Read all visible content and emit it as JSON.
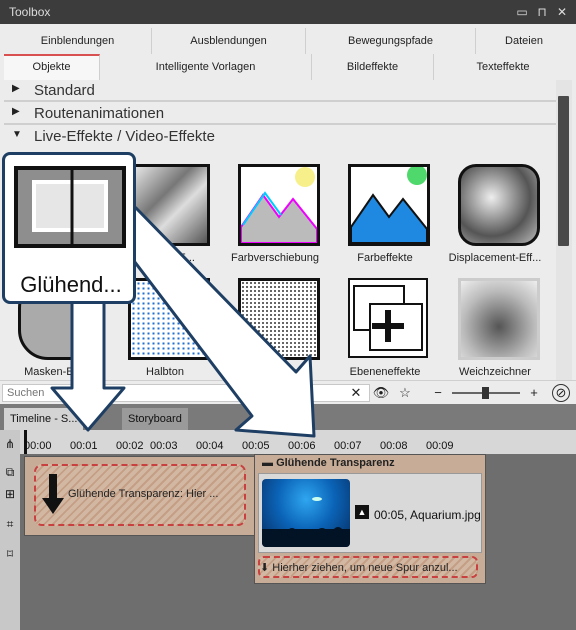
{
  "toolbox": {
    "title": "Toolbox",
    "window_controls": [
      "▭",
      "⊓",
      "✕"
    ],
    "tabs_row1": [
      "Einblendungen",
      "Ausblendungen",
      "Bewegungspfade",
      "Dateien"
    ],
    "tabs_row2": [
      "Objekte",
      "Intelligente Vorlagen",
      "Bildeffekte",
      "Texteffekte"
    ],
    "active_tab": "Objekte",
    "categories": [
      {
        "label": "Standard",
        "expanded": false
      },
      {
        "label": "Routenanimationen",
        "expanded": false
      },
      {
        "label": "Live-Effekte / Video-Effekte",
        "expanded": true
      }
    ],
    "effects": [
      {
        "label": "Glühende Transparenz",
        "icon": "glow-transparency-icon"
      },
      {
        "label": "Clipping-E...",
        "icon": "clipping-effect-icon"
      },
      {
        "label": "Farbverschiebung",
        "icon": "color-shift-icon"
      },
      {
        "label": "Farbeffekte",
        "icon": "color-effects-icon"
      },
      {
        "label": "Displacement-Eff...",
        "icon": "displacement-icon"
      },
      {
        "label": "Masken-Ef...",
        "icon": "mask-effect-icon"
      },
      {
        "label": "Halbton",
        "icon": "halftone-icon"
      },
      {
        "label": "...nfarbig",
        "icon": "monochrome-icon"
      },
      {
        "label": "Ebeneneffekte",
        "icon": "layer-effects-icon"
      },
      {
        "label": "Weichzeichner",
        "icon": "blur-icon"
      }
    ],
    "search_placeholder": "Suchen",
    "zoom_minus": "−",
    "zoom_plus": "+"
  },
  "timeline": {
    "tabs": [
      "Timeline - S...",
      "Storyboard"
    ],
    "ruler_ticks": [
      "00:00",
      "00:01",
      "00:02",
      "00:03",
      "00:04",
      "00:05",
      "00:06",
      "00:07",
      "00:08",
      "00:09"
    ],
    "placeholder_clip_label": "Glühende Transparenz: Hier ...",
    "effect_clip_title": "Glühende Transparenz",
    "media_info": "00:05, Aquarium.jpg",
    "drop_hint": "Hierher ziehen, um neue Spur anzul..."
  },
  "callout": {
    "label": "Glühend..."
  },
  "colors": {
    "accent_red": "#c84040",
    "callout_border": "#1e3f63",
    "clip_bg": "#c7ad97",
    "timeline_bg": "#6e6e6e"
  }
}
